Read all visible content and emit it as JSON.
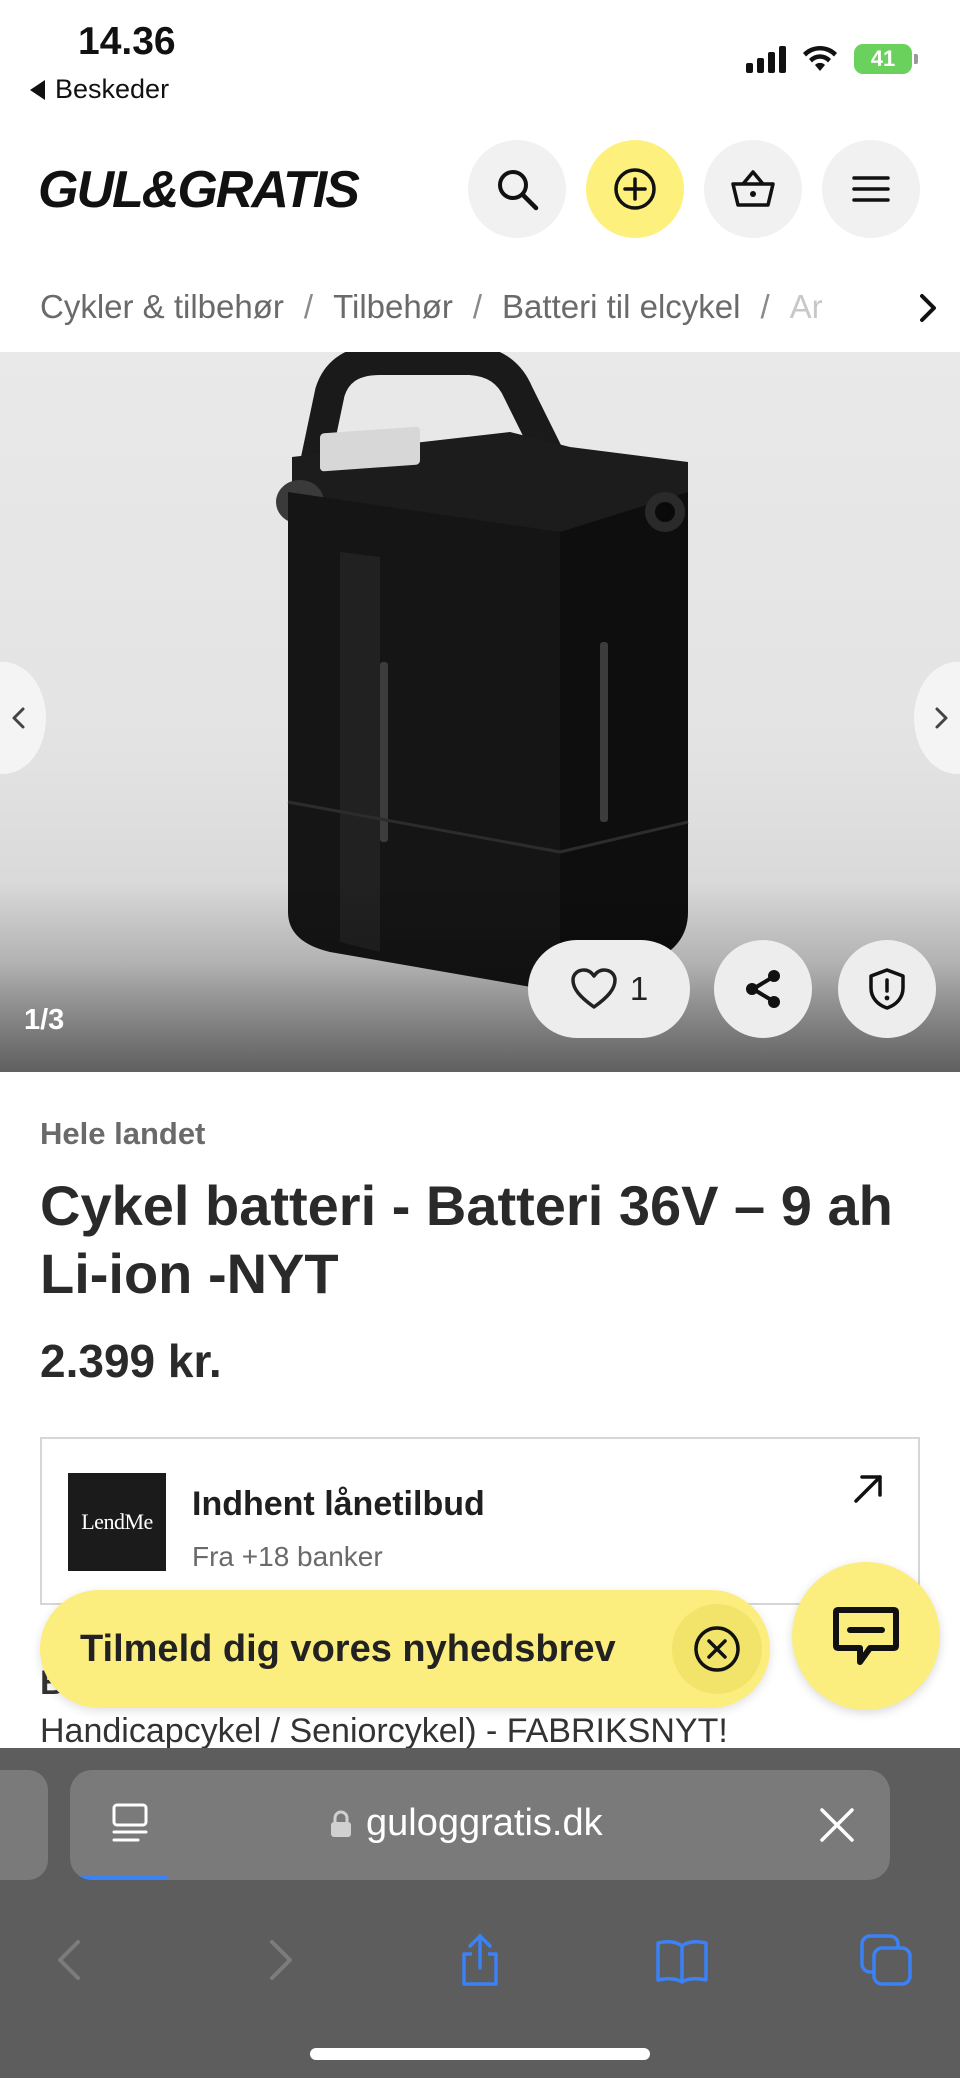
{
  "status_bar": {
    "time": "14.36",
    "back_label": "Beskeder",
    "battery": "41"
  },
  "header": {
    "logo": "GUL&GRATIS",
    "icons": [
      "search-icon",
      "add-icon",
      "basket-icon",
      "menu-icon"
    ]
  },
  "breadcrumb": {
    "items": [
      "Cykler & tilbehør",
      "Tilbehør",
      "Batteri til elcykel",
      "Ar"
    ]
  },
  "gallery": {
    "counter": "1/3",
    "like_count": "1"
  },
  "product": {
    "location": "Hele landet",
    "title": "Cykel batteri - Batteri 36V – 9 ah Li-ion -NYT",
    "price": "2.399 kr."
  },
  "loan": {
    "logo_text": "LendMe",
    "title": "Indhent lånetilbud",
    "subtitle": "Fra +18 banker"
  },
  "description": {
    "first_letter": "B",
    "line": "Handicapcykel / Seniorcykel) - FABRIKSNYT!"
  },
  "newsletter": {
    "label": "Tilmeld dig vores nyhedsbrev"
  },
  "browser": {
    "url": "guloggratis.dk"
  },
  "colors": {
    "accent_yellow": "#fbee7e",
    "safari_bar": "#5d5d5d",
    "link_blue": "#3b82f6"
  }
}
